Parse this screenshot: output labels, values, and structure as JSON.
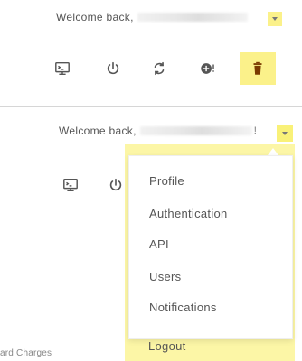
{
  "header_top": {
    "welcome_prefix": "Welcome back,",
    "menu_toggle_icon": "chevron-down-icon"
  },
  "toolbar_top": {
    "icons": [
      "console-icon",
      "power-icon",
      "sync-icon",
      "alert-icon",
      "trash-icon"
    ]
  },
  "header_bottom": {
    "welcome_prefix": "Welcome back,",
    "suffix": "!",
    "menu_toggle_icon": "chevron-down-icon"
  },
  "toolbar_bottom": {
    "icons": [
      "console-icon",
      "power-icon"
    ]
  },
  "dropdown": {
    "items": [
      "Profile",
      "Authentication",
      "API",
      "Users",
      "Notifications"
    ],
    "logout": "Logout"
  },
  "footer_fragment": "ard Charges",
  "colors": {
    "highlight": "#fbf18a",
    "text": "#555555",
    "separator": "#d6d6d6"
  }
}
